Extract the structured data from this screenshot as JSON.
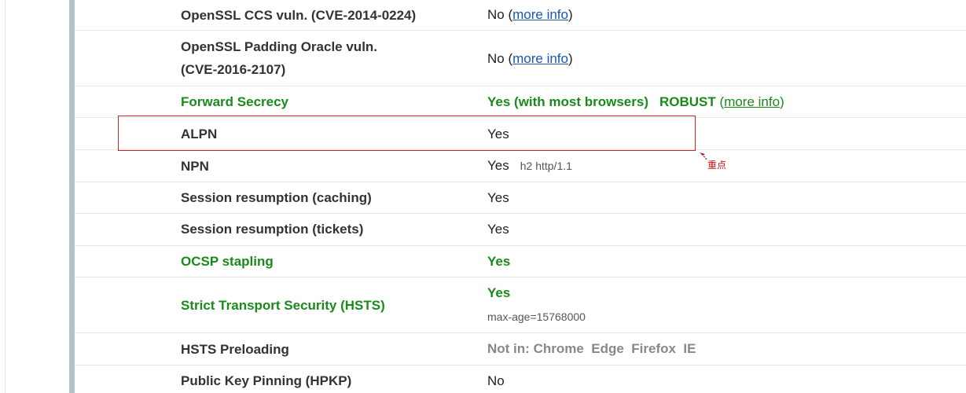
{
  "rows": [
    {
      "label": "OpenSSL CCS vuln. (CVE-2014-0224)",
      "value": "No",
      "link": "more info"
    },
    {
      "label_line1": "OpenSSL Padding Oracle vuln.",
      "label_line2": "(CVE-2016-2107)",
      "value": "No",
      "link": "more info"
    },
    {
      "label": "Forward Secrecy",
      "value": "Yes (with most browsers)",
      "extra": "ROBUST",
      "link": "more info"
    },
    {
      "label": "ALPN",
      "value": "Yes"
    },
    {
      "label": "NPN",
      "value": "Yes",
      "detail": "h2 http/1.1"
    },
    {
      "label": "Session resumption (caching)",
      "value": "Yes"
    },
    {
      "label": "Session resumption (tickets)",
      "value": "Yes"
    },
    {
      "label": "OCSP stapling",
      "value": "Yes"
    },
    {
      "label": "Strict Transport Security (HSTS)",
      "value": "Yes",
      "detail": "max-age=15768000"
    },
    {
      "label": "HSTS Preloading",
      "value_prefix": "Not in:",
      "browsers": [
        "Chrome",
        "Edge",
        "Firefox",
        "IE"
      ]
    },
    {
      "label": "Public Key Pinning (HPKP)",
      "value": "No"
    }
  ],
  "annotation": {
    "text": "重点"
  },
  "colors": {
    "green": "#1a8a1a",
    "link": "#1a55b0",
    "highlight": "#d02020",
    "sidebar": "#b4c2c9"
  }
}
